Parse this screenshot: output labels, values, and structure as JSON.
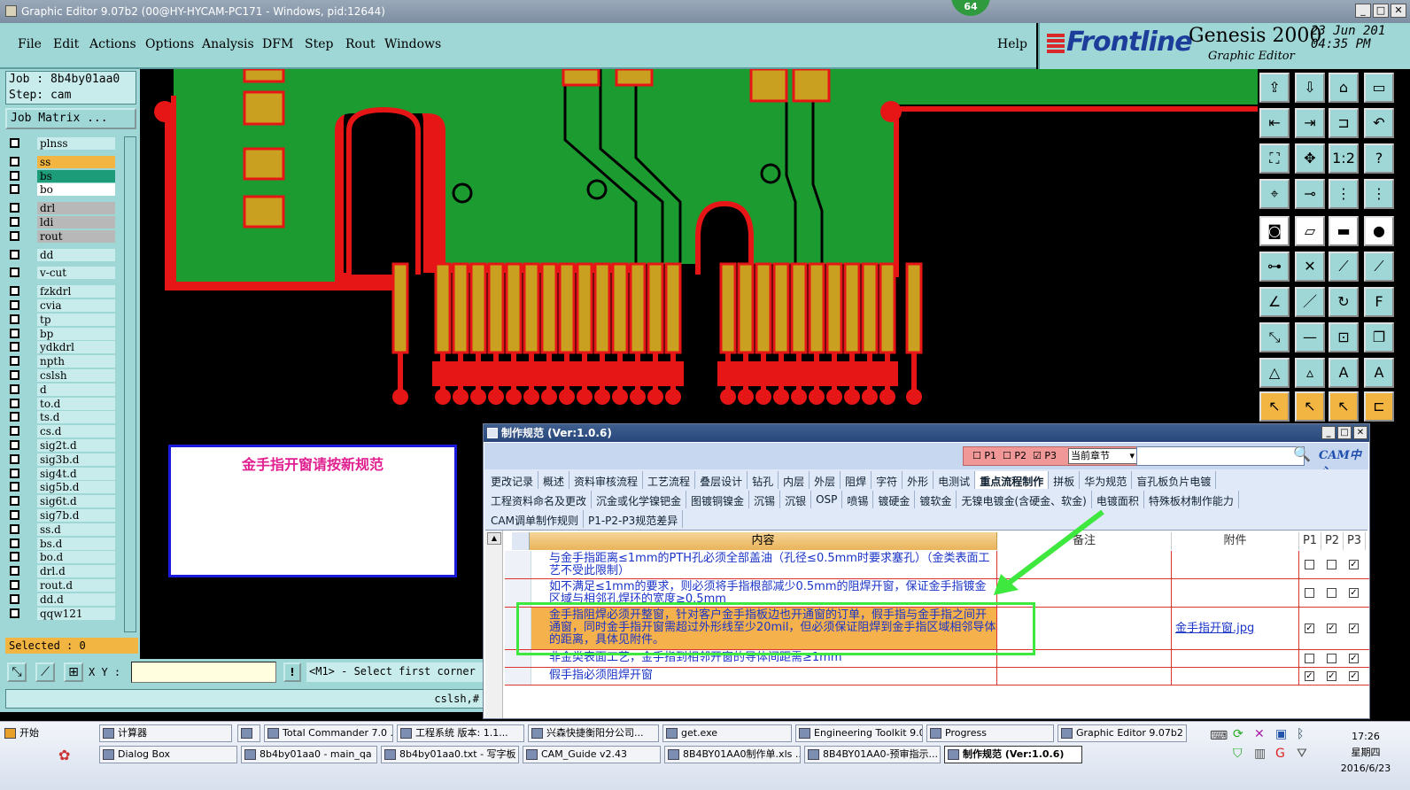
{
  "window": {
    "title": "Graphic Editor 9.07b2 (00@HY-HYCAM-PC171 - Windows, pid:12644)",
    "badge": "64"
  },
  "menu": [
    "File",
    "Edit",
    "Actions",
    "Options",
    "Analysis",
    "DFM",
    "Step",
    "Rout",
    "Windows"
  ],
  "help": "Help",
  "brand": {
    "logo": "Frontline",
    "product": "Genesis 2000",
    "subtitle": "Graphic Editor",
    "datetime": "23 Jun 201\n04:35 PM"
  },
  "job": {
    "job_line": "Job : 8b4by01aa0",
    "step_line": "Step: cam",
    "matrix_label": "Job Matrix ..."
  },
  "layers": [
    {
      "name": "plnss",
      "color": "",
      "gap": false
    },
    {
      "name": "ss",
      "color": "ss",
      "gap": true
    },
    {
      "name": "bs",
      "color": "bs",
      "gap": false
    },
    {
      "name": "bo",
      "color": "bo",
      "gap": false
    },
    {
      "name": "drl",
      "color": "gray",
      "gap": true
    },
    {
      "name": "ldi",
      "color": "gray",
      "gap": false
    },
    {
      "name": "rout",
      "color": "gray",
      "gap": false
    },
    {
      "name": "dd",
      "color": "",
      "gap": true
    },
    {
      "name": "v-cut",
      "color": "",
      "gap": true
    },
    {
      "name": "fzkdrl",
      "color": "",
      "gap": true
    },
    {
      "name": "cvia",
      "color": "",
      "gap": false
    },
    {
      "name": "tp",
      "color": "",
      "gap": false
    },
    {
      "name": "bp",
      "color": "",
      "gap": false
    },
    {
      "name": "ydkdrl",
      "color": "",
      "gap": false
    },
    {
      "name": "npth",
      "color": "",
      "gap": false
    },
    {
      "name": "cslsh",
      "color": "",
      "gap": false
    },
    {
      "name": "d",
      "color": "",
      "gap": false
    },
    {
      "name": "to.d",
      "color": "",
      "gap": false
    },
    {
      "name": "ts.d",
      "color": "",
      "gap": false
    },
    {
      "name": "cs.d",
      "color": "",
      "gap": false
    },
    {
      "name": "sig2t.d",
      "color": "",
      "gap": false
    },
    {
      "name": "sig3b.d",
      "color": "",
      "gap": false
    },
    {
      "name": "sig4t.d",
      "color": "",
      "gap": false
    },
    {
      "name": "sig5b.d",
      "color": "",
      "gap": false
    },
    {
      "name": "sig6t.d",
      "color": "",
      "gap": false
    },
    {
      "name": "sig7b.d",
      "color": "",
      "gap": false
    },
    {
      "name": "ss.d",
      "color": "",
      "gap": false
    },
    {
      "name": "bs.d",
      "color": "",
      "gap": false
    },
    {
      "name": "bo.d",
      "color": "",
      "gap": false
    },
    {
      "name": "drl.d",
      "color": "",
      "gap": false
    },
    {
      "name": "rout.d",
      "color": "",
      "gap": false
    },
    {
      "name": "dd.d",
      "color": "",
      "gap": false
    },
    {
      "name": "qqw121",
      "color": "",
      "gap": false
    }
  ],
  "selected": "Selected : 0",
  "cmd": {
    "xy_label": "X Y :",
    "prompt": "<M1> - Select first corner",
    "status": "cslsh,#"
  },
  "note": "金手指开窗请按新规范",
  "dialog": {
    "title": "制作规范 (Ver:1.0.6)",
    "filters": [
      "P1",
      "P2",
      "P3"
    ],
    "scope": "当前章节",
    "logo": "CAM中心",
    "tab_rows": [
      [
        "更改记录",
        "概述",
        "资料审核流程",
        "工艺流程",
        "叠层设计",
        "钻孔",
        "内层",
        "外层",
        "阻焊",
        "字符",
        "外形",
        "电测试",
        "重点流程制作",
        "拼板",
        "华为规范",
        "盲孔板负片电镀"
      ],
      [
        "工程资料命名及更改",
        "沉金或化学镍钯金",
        "图镀铜镍金",
        "沉锡",
        "沉银",
        "OSP",
        "喷锡",
        "镀硬金",
        "镀软金",
        "无镍电镀金(含硬金、软金)",
        "电镀面积",
        "特殊板材制作能力"
      ],
      [
        "CAM调单制作规则",
        "P1-P2-P3规范差异"
      ]
    ],
    "active_tab": "重点流程制作",
    "columns": [
      "内容",
      "备注",
      "附件",
      "P1",
      "P2",
      "P3"
    ],
    "rows": [
      {
        "content": "与金手指距离≤1mm的PTH孔必须全部盖油（孔径≤0.5mm时要求塞孔）（金类表面工艺不受此限制）",
        "note": "",
        "attachment": "",
        "p": [
          false,
          false,
          true
        ],
        "hl": false
      },
      {
        "content": "如不满足≤1mm的要求，则必须将手指根部减少0.5mm的阻焊开窗，保证金手指镀金区域与相邻孔焊环的宽度≥0.5mm",
        "note": "",
        "attachment": "",
        "p": [
          false,
          false,
          true
        ],
        "hl": false
      },
      {
        "content": "金手指阻焊必须开整窗，针对客户金手指板边也开通窗的订单，假手指与金手指之间开通窗，同时金手指开窗需超过外形线至少20mil，但必须保证阻焊到金手指区域相邻导体的距离，具体见附件。",
        "note": "",
        "attachment": "金手指开窗.jpg",
        "p": [
          true,
          true,
          true
        ],
        "hl": true
      },
      {
        "content": "非金类表面工艺，金手指到相邻开窗的导体间距需≥1mm",
        "note": "",
        "attachment": "",
        "p": [
          false,
          false,
          true
        ],
        "hl": false
      },
      {
        "content": "假手指必须阻焊开窗",
        "note": "",
        "attachment": "",
        "p": [
          true,
          true,
          true
        ],
        "hl": false
      }
    ]
  },
  "taskbar": {
    "start": "开始",
    "row1": [
      "计算器",
      "",
      "Total Commander 7.0 ...",
      "工程系统  版本: 1.1...",
      "兴森快捷衡阳分公司...",
      "get.exe",
      "Engineering Toolkit 9.0...",
      "Progress",
      "Graphic Editor 9.07b2 ..."
    ],
    "row2": [
      "Dialog Box",
      "8b4by01aa0 - main_qa",
      "8b4by01aa0.txt - 写字板",
      "CAM_Guide v2.43",
      "8B4BY01AA0制作单.xls ...",
      "8B4BY01AA0-预审指示...",
      "制作规范 (Ver:1.0.6)"
    ],
    "active": "制作规范 (Ver:1.0.6)",
    "clock": {
      "time": "17:26",
      "weekday": "星期四",
      "date": "2016/6/23"
    }
  }
}
